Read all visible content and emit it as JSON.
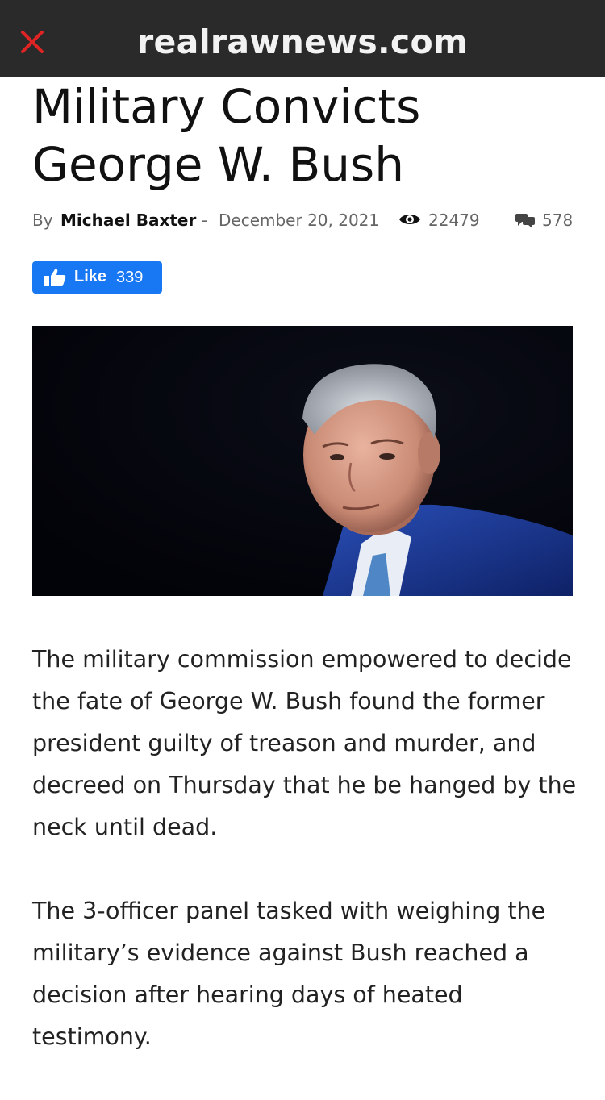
{
  "browser": {
    "domain": "realrawnews.com"
  },
  "article": {
    "title": "Military Convicts George W. Bush",
    "byline_prefix": "By",
    "author": "Michael Baxter",
    "separator": "-",
    "date": "December 20, 2021",
    "views": "22479",
    "comments": "578",
    "like_label": "Like",
    "like_count": "339",
    "paragraphs": [
      "The military commission empowered to decide the fate of George W. Bush found the former president guilty of treason and murder, and decreed on Thursday that he be hanged by the neck until dead.",
      "The 3-officer panel tasked with weighing the military’s evidence against Bush reached a decision after hearing days of heated testimony."
    ]
  },
  "colors": {
    "topbar": "#2a2a2a",
    "close_icon": "#e02424",
    "like_button": "#1877f2"
  },
  "icons": [
    "close-icon",
    "eye-icon",
    "comments-icon",
    "thumbs-up-icon"
  ]
}
